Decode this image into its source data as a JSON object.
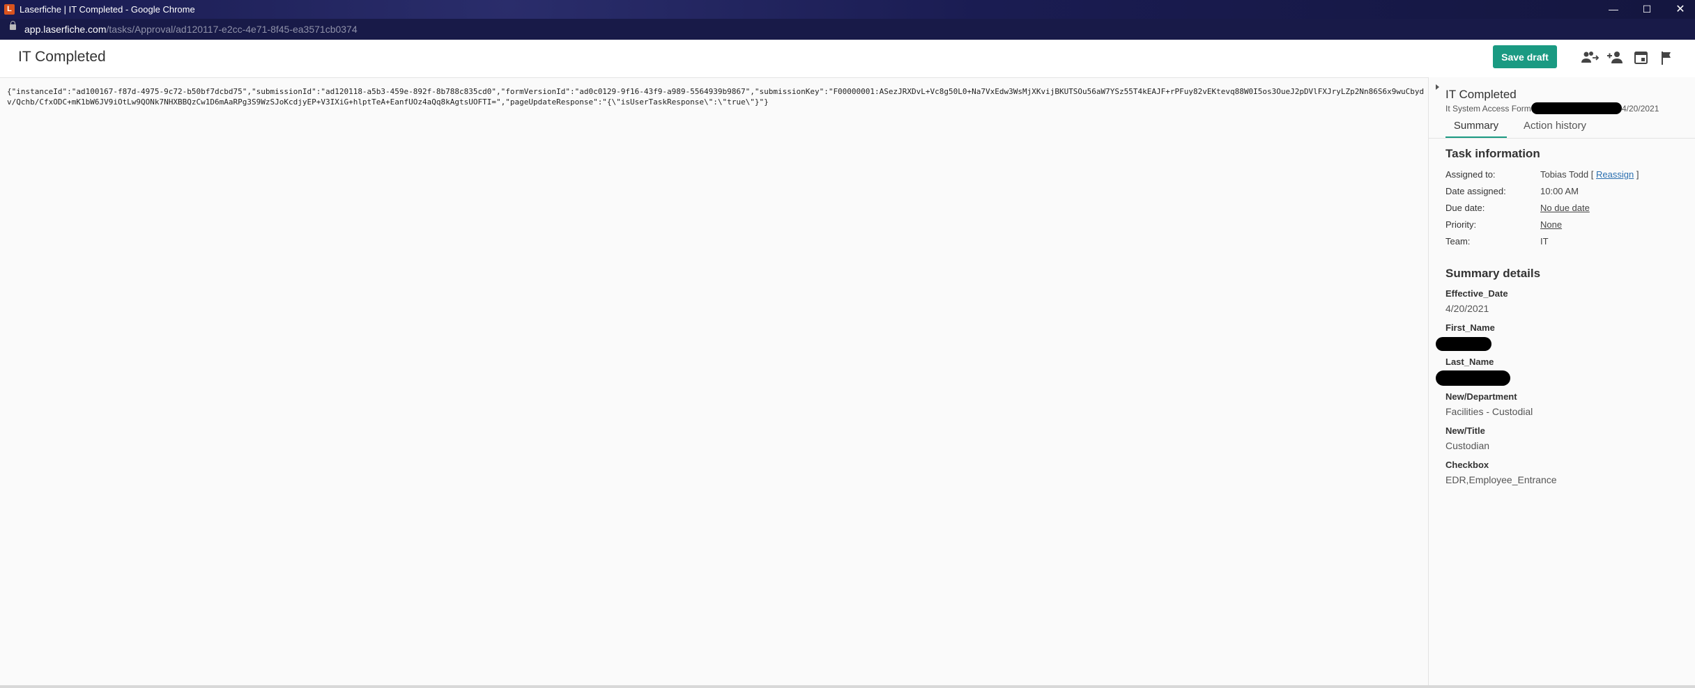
{
  "window": {
    "title": "Laserfiche | IT Completed - Google Chrome",
    "app_icon_letter": "L",
    "minimize": "—",
    "maximize": "☐",
    "close": "✕"
  },
  "address": {
    "host": "app.laserfiche.com",
    "path": "/tasks/Approval/ad120117-e2cc-4e71-8f45-ea3571cb0374"
  },
  "header": {
    "title": "IT Completed",
    "save_draft_label": "Save draft",
    "icons": [
      "reassign-users-icon",
      "add-user-icon",
      "calendar-icon",
      "flag-icon"
    ]
  },
  "main": {
    "json_text": "{\"instanceId\":\"ad100167-f87d-4975-9c72-b50bf7dcbd75\",\"submissionId\":\"ad120118-a5b3-459e-892f-8b788c835cd0\",\"formVersionId\":\"ad0c0129-9f16-43f9-a989-5564939b9867\",\"submissionKey\":\"F00000001:ASezJRXDvL+Vc8g50L0+Na7VxEdw3WsMjXKvijBKUTSOu56aW7YSz55T4kEAJF+rPFuy82vEKtevq88W0I5os3OueJ2pDVlFXJryLZp2Nn86S6x9wuCbydv/Qchb/CfxODC+mK1bW6JV9iOtLw9QONk7NHXBBQzCw1D6mAaRPg3S9WzSJoKcdjyEP+V3IXiG+hlptTeA+EanfUOz4aQq8kAgtsUOFTI=\",\"pageUpdateResponse\":\"{\\\"isUserTaskResponse\\\":\\\"true\\\"}\"}"
  },
  "side": {
    "task_title": "IT Completed",
    "form_name": "It System Access Form",
    "date": "4/20/2021",
    "tabs": [
      "Summary",
      "Action history"
    ],
    "task_info": {
      "heading": "Task information",
      "rows": [
        {
          "label": "Assigned to:",
          "value": "Tobias Todd",
          "bracket_open": "[",
          "link": "Reassign",
          "bracket_close": "]"
        },
        {
          "label": "Date assigned:",
          "value": "10:00 AM"
        },
        {
          "label": "Due date:",
          "link": "No due date"
        },
        {
          "label": "Priority:",
          "link": "None"
        },
        {
          "label": "Team:",
          "value": "IT"
        }
      ]
    },
    "summary": {
      "heading": "Summary details",
      "fields": [
        {
          "label": "Effective_Date",
          "value": "4/20/2021"
        },
        {
          "label": "First_Name",
          "value": ""
        },
        {
          "label": "Last_Name",
          "value": ""
        },
        {
          "label": "New/Department",
          "value": "Facilities - Custodial"
        },
        {
          "label": "New/Title",
          "value": "Custodian"
        },
        {
          "label": "Checkbox",
          "value": "EDR,Employee_Entrance"
        }
      ]
    }
  }
}
